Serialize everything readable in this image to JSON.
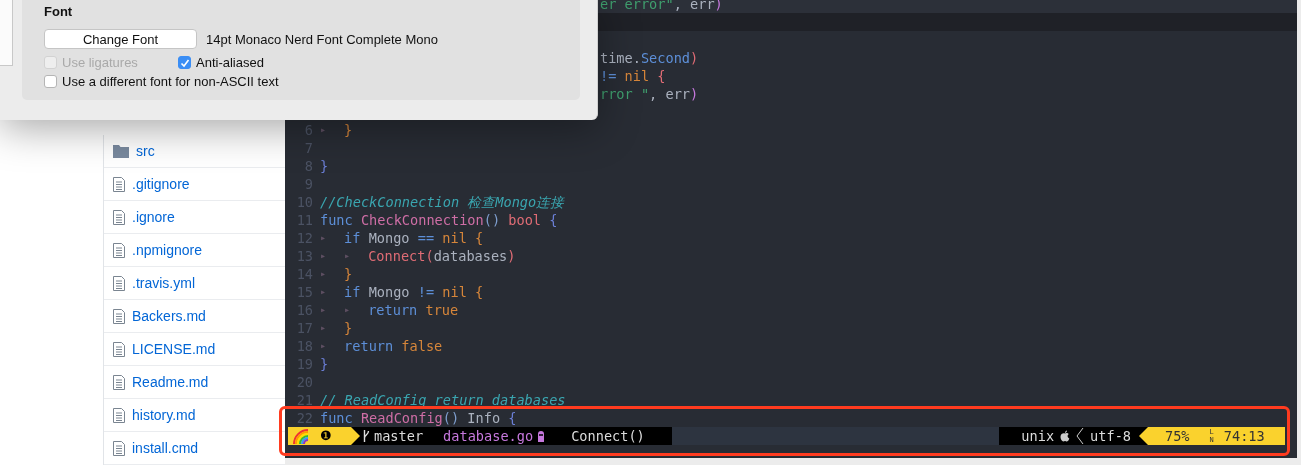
{
  "dialog": {
    "section_title": "Font",
    "change_font_button": "Change Font",
    "font_name": "14pt Monaco Nerd Font Complete Mono",
    "options": [
      {
        "label": "Use ligatures",
        "checked": false,
        "disabled": true
      },
      {
        "label": "Anti-aliased",
        "checked": true,
        "disabled": false
      },
      {
        "label": "Use a different font for non-ASCII text",
        "checked": false,
        "disabled": false
      }
    ]
  },
  "files": [
    {
      "name": "src",
      "kind": "folder"
    },
    {
      "name": ".gitignore",
      "kind": "file"
    },
    {
      "name": ".ignore",
      "kind": "file"
    },
    {
      "name": ".npmignore",
      "kind": "file"
    },
    {
      "name": ".travis.yml",
      "kind": "file"
    },
    {
      "name": "Backers.md",
      "kind": "file"
    },
    {
      "name": "LICENSE.md",
      "kind": "file"
    },
    {
      "name": "Readme.md",
      "kind": "file"
    },
    {
      "name": "history.md",
      "kind": "file"
    },
    {
      "name": "install.cmd",
      "kind": "file"
    }
  ],
  "editor": {
    "lines": [
      {
        "kind": "partial",
        "tokens": [
          {
            "text": "er error\"",
            "kind": "string"
          },
          {
            "text": ", err",
            "kind": "plain"
          },
          {
            "text": ")",
            "kind": "paren2"
          }
        ]
      },
      {
        "kind": "band"
      },
      {
        "kind": "blank"
      },
      {
        "kind": "partial",
        "tokens": [
          {
            "text": "time.",
            "kind": "plain"
          },
          {
            "text": "Second",
            "kind": "kw"
          },
          {
            "text": ")",
            "kind": "call"
          }
        ]
      },
      {
        "kind": "partial",
        "tokens": [
          {
            "text": "!=",
            "kind": "op"
          },
          {
            "text": " nil",
            "kind": "const"
          },
          {
            "text": " {",
            "kind": "call"
          }
        ]
      },
      {
        "kind": "partial",
        "tokens": [
          {
            "text": "rror \"",
            "kind": "string"
          },
          {
            "text": ", err",
            "kind": "plain"
          },
          {
            "text": ")",
            "kind": "paren2"
          }
        ]
      },
      {
        "kind": "blank"
      },
      {
        "kind": "code",
        "number": "6",
        "tokens": [
          {
            "kind": "guide",
            "text": "▸"
          },
          {
            "text": "}",
            "kind": "brace2"
          }
        ]
      },
      {
        "kind": "code",
        "number": "7"
      },
      {
        "kind": "code",
        "number": "8",
        "tokens": [
          {
            "text": "}",
            "kind": "brace"
          }
        ]
      },
      {
        "kind": "code",
        "number": "9"
      },
      {
        "kind": "code",
        "number": "10",
        "tokens": [
          {
            "text": "//CheckConnection 检查Mongo连接",
            "kind": "comment"
          }
        ]
      },
      {
        "kind": "code",
        "number": "11",
        "tokens": [
          {
            "text": "func",
            "kind": "kw"
          },
          {
            "text": " CheckConnection",
            "kind": "fn"
          },
          {
            "text": "()",
            "kind": "paren"
          },
          {
            "text": " bool",
            "kind": "type"
          },
          {
            "text": " {",
            "kind": "brace"
          }
        ]
      },
      {
        "kind": "code",
        "number": "12",
        "tokens": [
          {
            "kind": "guide",
            "text": "▸"
          },
          {
            "text": "if",
            "kind": "kw"
          },
          {
            "text": " Mongo",
            "kind": "plain"
          },
          {
            "text": " ==",
            "kind": "op"
          },
          {
            "text": " nil",
            "kind": "const"
          },
          {
            "text": " {",
            "kind": "brace2"
          }
        ]
      },
      {
        "kind": "code",
        "number": "13",
        "tokens": [
          {
            "kind": "guide",
            "text": "▸"
          },
          {
            "kind": "guide",
            "text": "▸"
          },
          {
            "text": "Connect(",
            "kind": "call"
          },
          {
            "text": "databases",
            "kind": "plain"
          },
          {
            "text": ")",
            "kind": "call"
          }
        ]
      },
      {
        "kind": "code",
        "number": "14",
        "tokens": [
          {
            "kind": "guide",
            "text": "▸"
          },
          {
            "text": "}",
            "kind": "brace2"
          }
        ]
      },
      {
        "kind": "code",
        "number": "15",
        "tokens": [
          {
            "kind": "guide",
            "text": "▸"
          },
          {
            "text": "if",
            "kind": "kw"
          },
          {
            "text": " Mongo",
            "kind": "plain"
          },
          {
            "text": " !=",
            "kind": "op"
          },
          {
            "text": " nil",
            "kind": "const"
          },
          {
            "text": " {",
            "kind": "brace2"
          }
        ]
      },
      {
        "kind": "code",
        "number": "16",
        "tokens": [
          {
            "kind": "guide",
            "text": "▸"
          },
          {
            "kind": "guide",
            "text": "▸"
          },
          {
            "text": "return",
            "kind": "kw"
          },
          {
            "text": " true",
            "kind": "const"
          }
        ]
      },
      {
        "kind": "code",
        "number": "17",
        "tokens": [
          {
            "kind": "guide",
            "text": "▸"
          },
          {
            "text": "}",
            "kind": "brace2"
          }
        ]
      },
      {
        "kind": "code",
        "number": "18",
        "tokens": [
          {
            "kind": "guide",
            "text": "▸"
          },
          {
            "text": "return",
            "kind": "kw"
          },
          {
            "text": " false",
            "kind": "const"
          }
        ]
      },
      {
        "kind": "code",
        "number": "19",
        "tokens": [
          {
            "text": "}",
            "kind": "brace"
          }
        ]
      },
      {
        "kind": "code",
        "number": "20"
      },
      {
        "kind": "code",
        "number": "21",
        "tokens": [
          {
            "text": "// ReadConfig return databases",
            "kind": "comment"
          }
        ]
      },
      {
        "kind": "code",
        "number": "22",
        "tokens": [
          {
            "text": "func",
            "kind": "kw"
          },
          {
            "text": " ReadConfig",
            "kind": "fn"
          },
          {
            "text": "()",
            "kind": "paren"
          },
          {
            "text": " Info",
            "kind": "plain"
          },
          {
            "text": " {",
            "kind": "brace"
          }
        ]
      }
    ]
  },
  "status_bar": {
    "badge": "❶",
    "branch": "master",
    "file": "database.go",
    "function": "Connect()",
    "format": "unix",
    "encoding": "utf-8",
    "percent": "75%",
    "line_symbol": "LN",
    "position": "74:13"
  }
}
